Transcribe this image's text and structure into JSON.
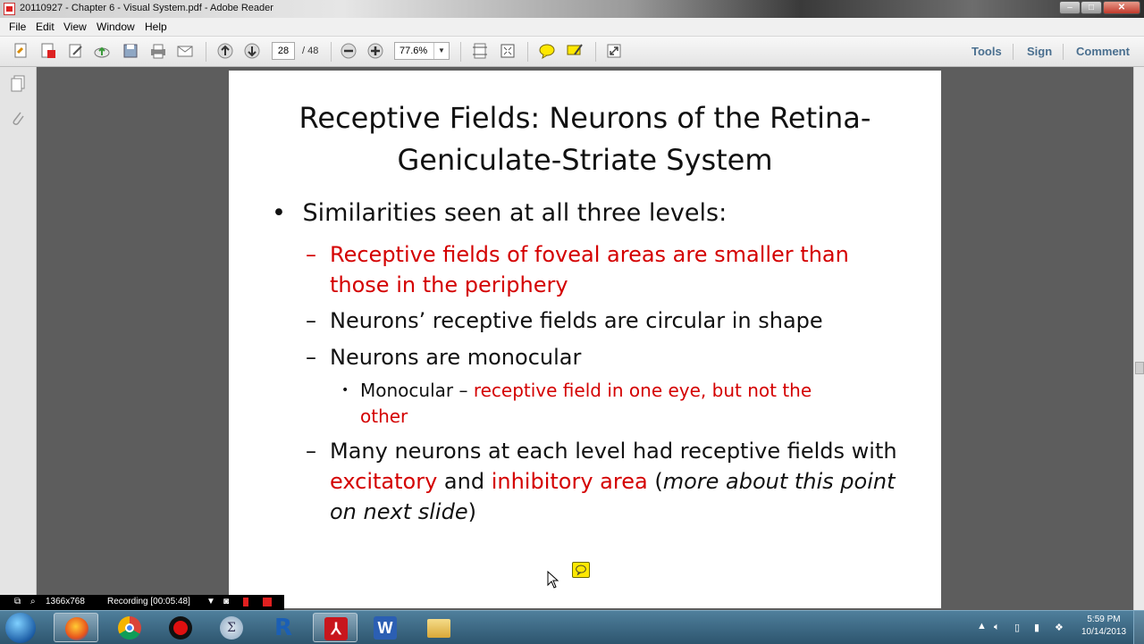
{
  "window": {
    "title": "20110927 - Chapter 6 - Visual System.pdf - Adobe Reader",
    "minimize": "–",
    "maximize": "□",
    "close": "✕"
  },
  "menu": {
    "items": [
      "File",
      "Edit",
      "View",
      "Window",
      "Help"
    ]
  },
  "toolbar": {
    "icons": [
      "create-pdf-icon",
      "export-pdf-icon",
      "edit-icon",
      "cloud-upload-icon",
      "save-icon",
      "print-icon",
      "email-icon",
      "page-up-icon",
      "page-down-icon",
      "zoom-out-icon",
      "zoom-in-icon",
      "fit-page-icon",
      "fit-width-icon",
      "comment-icon",
      "highlight-icon",
      "full-screen-icon"
    ],
    "page_current": "28",
    "page_sep_total": "/ 48",
    "zoom": "77.6%",
    "tools_label": "Tools",
    "sign_label": "Sign",
    "comment_label": "Comment"
  },
  "slide": {
    "title": "Receptive Fields: Neurons of the Retina-Geniculate-Striate System",
    "bullet1": "Similarities seen at all three levels:",
    "bullet1_marker": "•",
    "dash": "–",
    "sub1": "Receptive fields of foveal areas are smaller than those in the periphery",
    "sub2": "Neurons’ receptive fields are circular in shape",
    "sub3": "Neurons are monocular",
    "subsub_marker": "•",
    "subsub_lead": "Monocular – ",
    "subsub_red": "receptive field in one eye, but not the other",
    "sub4_a": "Many neurons at each level had receptive fields with ",
    "sub4_red1": "excitatory",
    "sub4_mid": " and ",
    "sub4_red2": "inhibitory area",
    "sub4_open": " (",
    "sub4_italic": "more about this point on next slide",
    "sub4_close": ")",
    "highlight_color": "#d40000"
  },
  "recording": {
    "resolution": "1366x768",
    "status": "Recording [00:05:48]"
  },
  "taskbar": {
    "apps": [
      "windows-start-icon",
      "firefox-icon",
      "chrome-icon",
      "record-icon",
      "math-icon",
      "r-icon",
      "adobe-reader-icon",
      "word-icon",
      "folder-icon"
    ],
    "time": "5:59 PM",
    "date": "10/14/2013"
  }
}
